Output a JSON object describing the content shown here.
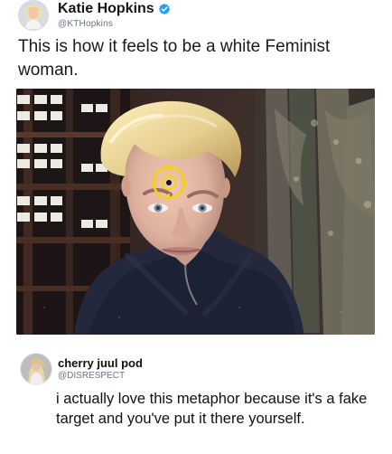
{
  "tweet": {
    "author": {
      "display_name": "Katie Hopkins",
      "handle": "@KTHopkins",
      "verified": true,
      "avatar_icon": "profile-avatar-blonde-woman"
    },
    "text": "This is how it feels to be a white Feminist woman.",
    "media": {
      "icon": "photo-woman-with-target-on-forehead",
      "accent_color": "#f5d400"
    }
  },
  "reply": {
    "author": {
      "display_name": "cherry juul pod",
      "handle": "@DISRESPECT",
      "avatar_icon": "profile-avatar-blonde-person"
    },
    "text": "i actually love this metaphor because it's a fake target and you've put it there yourself."
  },
  "colors": {
    "background": "#ffffff",
    "primary_text": "#14171a",
    "secondary_text": "#657786",
    "verified": "#1da1f2",
    "target": "#f5d400"
  }
}
